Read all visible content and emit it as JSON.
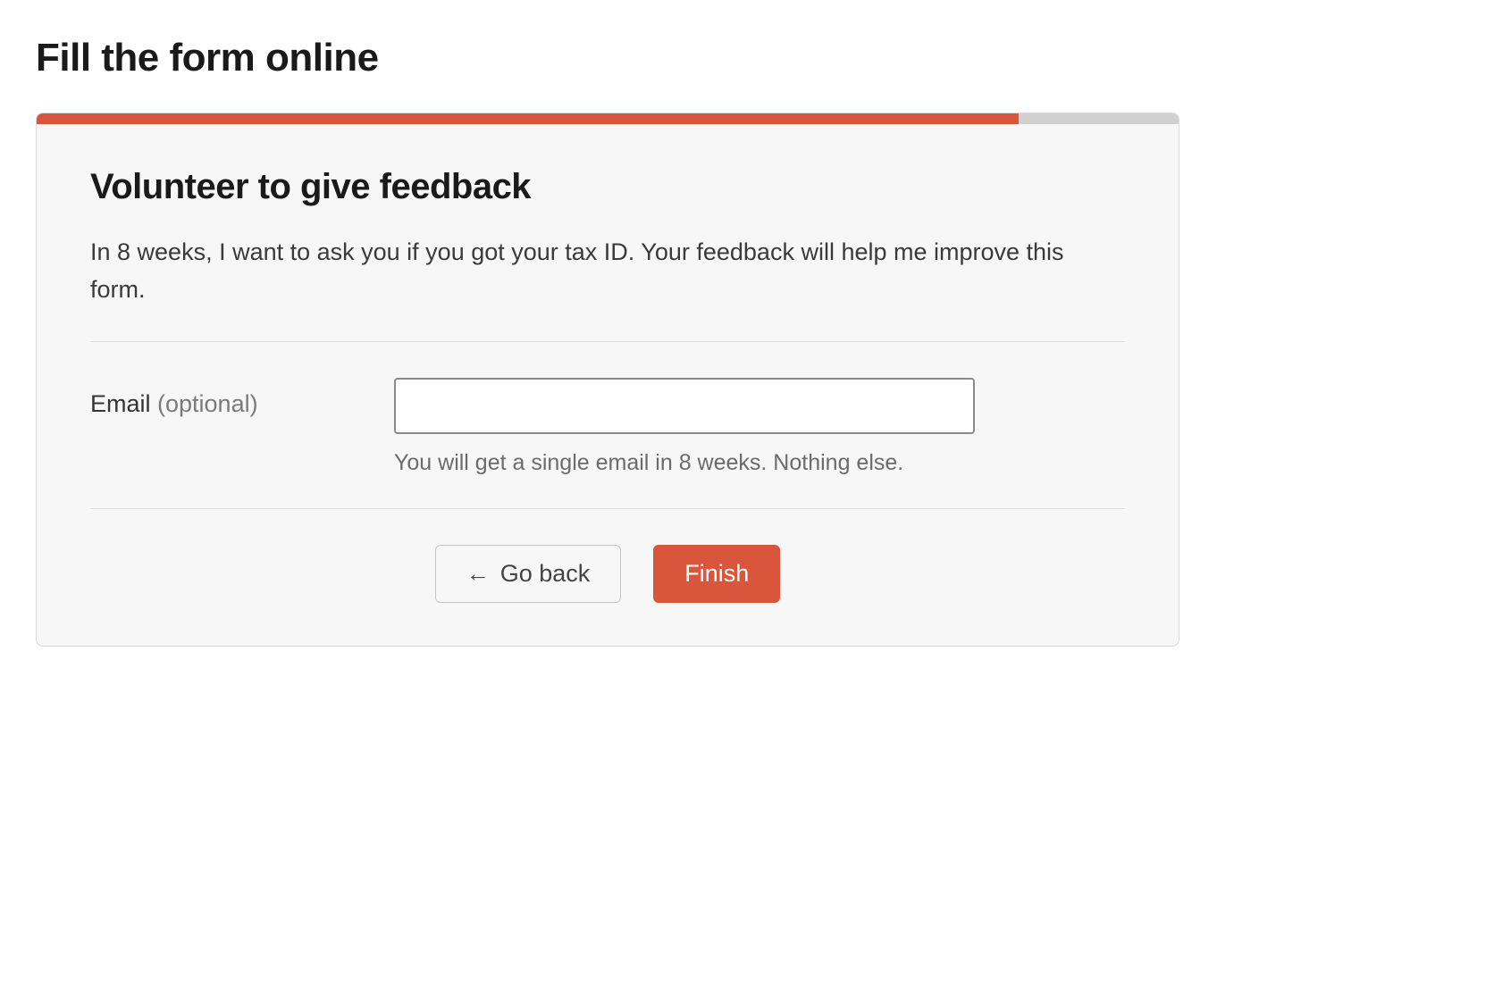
{
  "page": {
    "title": "Fill the form online"
  },
  "progress": {
    "percent": 86,
    "accent": "#d9553b"
  },
  "section": {
    "heading": "Volunteer to give feedback",
    "description": "In 8 weeks, I want to ask you if you got your tax ID. Your feedback will help me improve this form."
  },
  "form": {
    "email": {
      "label": "Email ",
      "optional_text": "(optional)",
      "value": "",
      "help": "You will get a single email in 8 weeks. Nothing else."
    }
  },
  "buttons": {
    "back": "Go back",
    "finish": "Finish"
  },
  "icons": {
    "arrow_left": "←"
  }
}
